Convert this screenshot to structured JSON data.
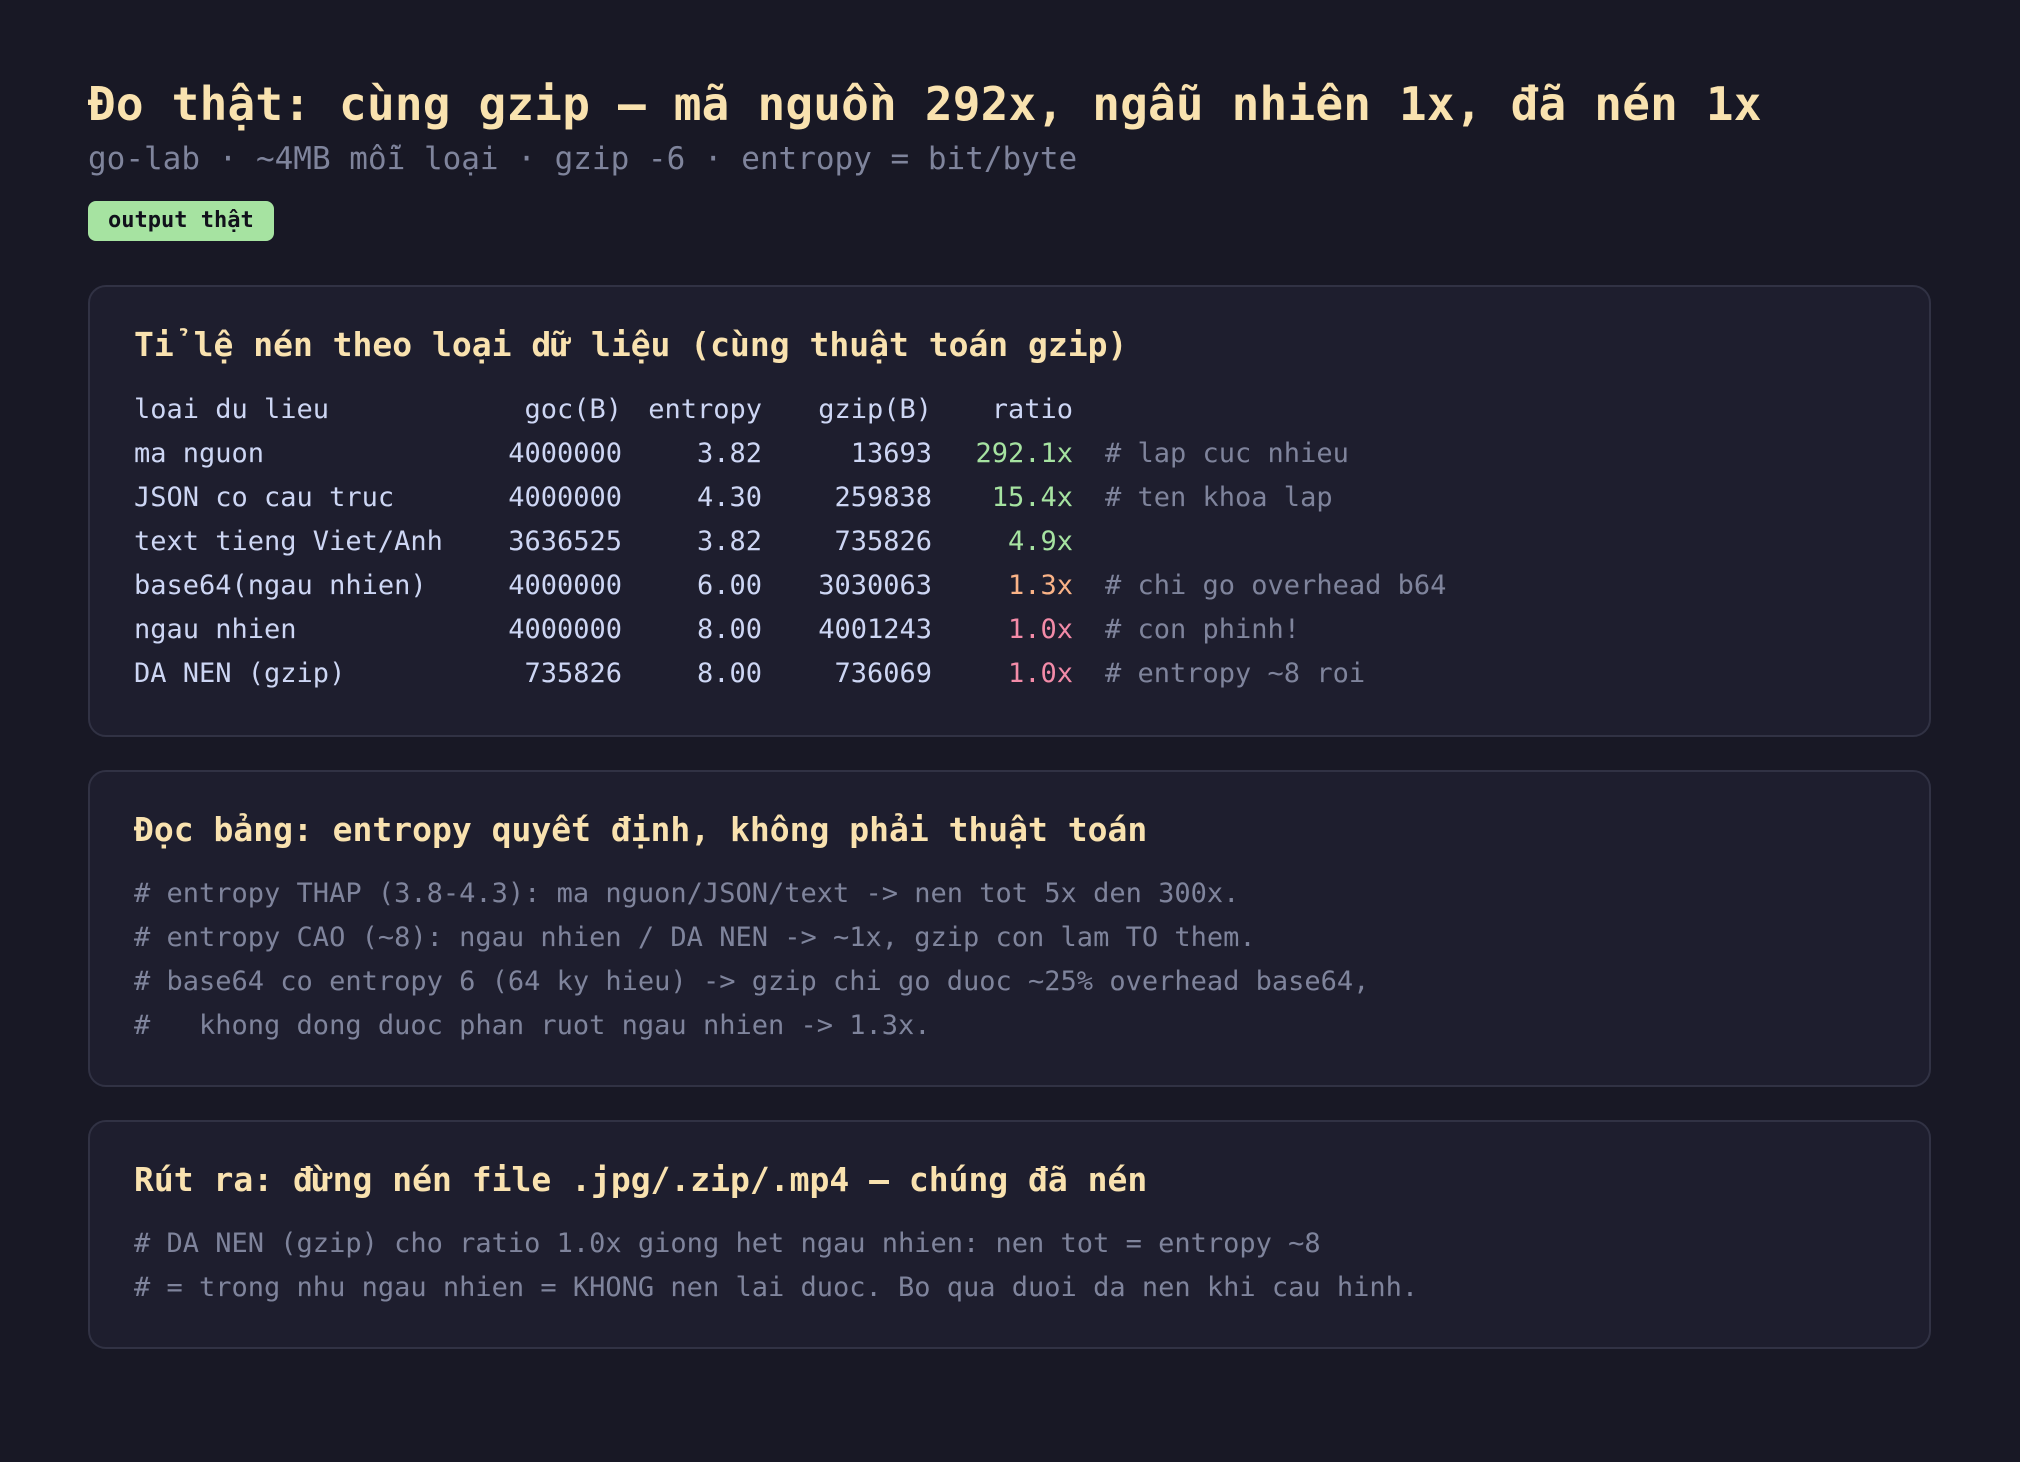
{
  "header": {
    "title": "Đo thật: cùng gzip — mã nguồn 292x, ngẫu nhiên 1x, đã nén 1x",
    "subtitle": "go-lab · ~4MB mỗi loại · gzip -6 · entropy = bit/byte",
    "badge": "output thật",
    "badge_color": "#a6e3a1",
    "accent_color": "#f9e2af"
  },
  "table_card": {
    "title": "Tỉ lệ nén theo loại dữ liệu (cùng thuật toán gzip)",
    "columns": [
      "loai du lieu",
      "goc(B)",
      "entropy",
      "gzip(B)",
      "ratio"
    ],
    "rows": [
      {
        "type": "ma nguon",
        "orig": "4000000",
        "entropy": "3.82",
        "gzip": "13693",
        "ratio": "292.1x",
        "comment": "# lap cuc nhieu",
        "ratio_color": "#a6e3a1"
      },
      {
        "type": "JSON co cau truc",
        "orig": "4000000",
        "entropy": "4.30",
        "gzip": "259838",
        "ratio": "15.4x",
        "comment": "# ten khoa lap",
        "ratio_color": "#a6e3a1"
      },
      {
        "type": "text tieng Viet/Anh",
        "orig": "3636525",
        "entropy": "3.82",
        "gzip": "735826",
        "ratio": "4.9x",
        "comment": "",
        "ratio_color": "#a6e3a1"
      },
      {
        "type": "base64(ngau nhien)",
        "orig": "4000000",
        "entropy": "6.00",
        "gzip": "3030063",
        "ratio": "1.3x",
        "comment": "# chi go overhead b64",
        "ratio_color": "#fab387"
      },
      {
        "type": "ngau nhien",
        "orig": "4000000",
        "entropy": "8.00",
        "gzip": "4001243",
        "ratio": "1.0x",
        "comment": "# con phinh!",
        "ratio_color": "#f38ba8"
      },
      {
        "type": "DA NEN (gzip)",
        "orig": "735826",
        "entropy": "8.00",
        "gzip": "736069",
        "ratio": "1.0x",
        "comment": "# entropy ~8 roi",
        "ratio_color": "#f38ba8"
      }
    ]
  },
  "explain_card": {
    "title": "Đọc bảng: entropy quyết định, không phải thuật toán",
    "lines": [
      "# entropy THAP (3.8-4.3): ma nguon/JSON/text -> nen tot 5x den 300x.",
      "# entropy CAO (~8): ngau nhien / DA NEN -> ~1x, gzip con lam TO them.",
      "# base64 co entropy 6 (64 ky hieu) -> gzip chi go duoc ~25% overhead base64,",
      "#   khong dong duoc phan ruot ngau nhien -> 1.3x."
    ]
  },
  "conclusion_card": {
    "title": "Rút ra: đừng nén file .jpg/.zip/.mp4 — chúng đã nén",
    "lines": [
      "# DA NEN (gzip) cho ratio 1.0x giong het ngau nhien: nen tot = entropy ~8",
      "# = trong nhu ngau nhien = KHONG nen lai duoc. Bo qua duoi da nen khi cau hinh."
    ]
  }
}
